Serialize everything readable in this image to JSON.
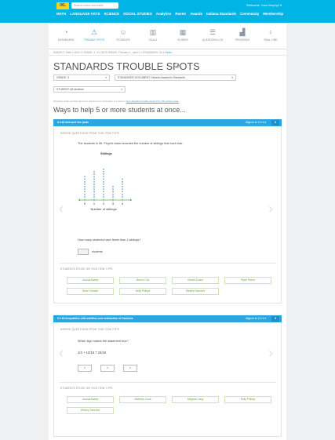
{
  "topbar": {
    "logo": "IXL",
    "search_placeholder": "Search topics and skills",
    "welcome": "Welcome, Lisa Murphy! ▾",
    "nav": [
      "MATH",
      "LANGUAGE ARTS",
      "SCIENCE",
      "SOCIAL STUDIES",
      "Analytics",
      "Roster",
      "Awards",
      "Indiana Standards",
      "Community",
      "Membership"
    ],
    "accent": "#00b4e5"
  },
  "iconbar": {
    "items": [
      {
        "label": "DASHBOARD",
        "icon": "dashboard-icon"
      },
      {
        "label": "TROUBLE SPOTS",
        "icon": "warning-icon"
      },
      {
        "label": "STUDENTS",
        "icon": "students-icon"
      },
      {
        "label": "SKILLS",
        "icon": "skills-icon"
      },
      {
        "label": "SCORES",
        "icon": "scores-icon"
      },
      {
        "label": "QUESTIONS LOG",
        "icon": "questions-log-icon"
      },
      {
        "label": "PROGRESS",
        "icon": "progress-icon"
      },
      {
        "label": "REAL-TIME",
        "icon": "real-time-icon"
      }
    ],
    "active_index": 1
  },
  "breadcrumb": {
    "text": "SUBJECT: Math ▾   SKILLS GRADE: 4 - 8 ▾   DATE RANGE: February 1 - April 1 ▾   STANDARDS: On ▾",
    "link": "Reset"
  },
  "page": {
    "title": "STANDARDS TROUBLE SPOTS",
    "help": "?",
    "grade_select": "GRADE: 3",
    "standards_doc_select": "STANDARDS DOCUMENT: Indiana Academic Standards",
    "student_select": "STUDENT: All students",
    "info": "Showing active trouble spots for practice from February 1 to April 1.",
    "info_link": "See all active trouble spots from this school year.",
    "subheading": "Ways to help 5 or more students at once..."
  },
  "card1": {
    "header": "3.4.16 Interpret line plots",
    "flag": "Aligned to 3.4.5 ▾",
    "count": "6",
    "missed_label": "MISSED QUESTIONS FROM THIS ITEM TYPE",
    "question": "The students in Mr. Floyd's class recorded the number of siblings that each has.",
    "plot_title": "Siblings",
    "xlabel": "Number of siblings",
    "ask": "How many students have fewer than 2 siblings?",
    "unit": "students",
    "stuck_label": "STUDENTS STUCK ON THIS ITEM TYPE",
    "students": [
      "Joshua Bailey",
      "Marvin Cox",
      "Gerald Evans",
      "Ryan Flores",
      "Drew Graham",
      "Kelly Phillips",
      "Wesley Sanchez"
    ]
  },
  "chart_data": {
    "type": "scatter",
    "title": "Siblings",
    "xlabel": "Number of siblings",
    "ylabel": "",
    "categories": [
      "0",
      "1",
      "2",
      "3",
      "4"
    ],
    "values": [
      9,
      11,
      12,
      5,
      8
    ]
  },
  "card2": {
    "header": "3.1.16 Inequalities with addition and subtraction of fractions",
    "flag": "Aligned to 3.1.4 ▾",
    "count": "5",
    "missed_label": "MISSED QUESTIONS FROM THIS ITEM TYPE",
    "question": "Which sign makes the statement true?",
    "expression": "1/4 + 12/16  ?  15/16",
    "choices": [
      "<",
      "=",
      ">"
    ],
    "stuck_label": "STUDENTS STUCK ON THIS ITEM TYPE",
    "students": [
      "Joshua Bailey",
      "Matthew Cook",
      "Meghan Long",
      "Kelly Phillips",
      "Wesley Sanchez"
    ]
  }
}
